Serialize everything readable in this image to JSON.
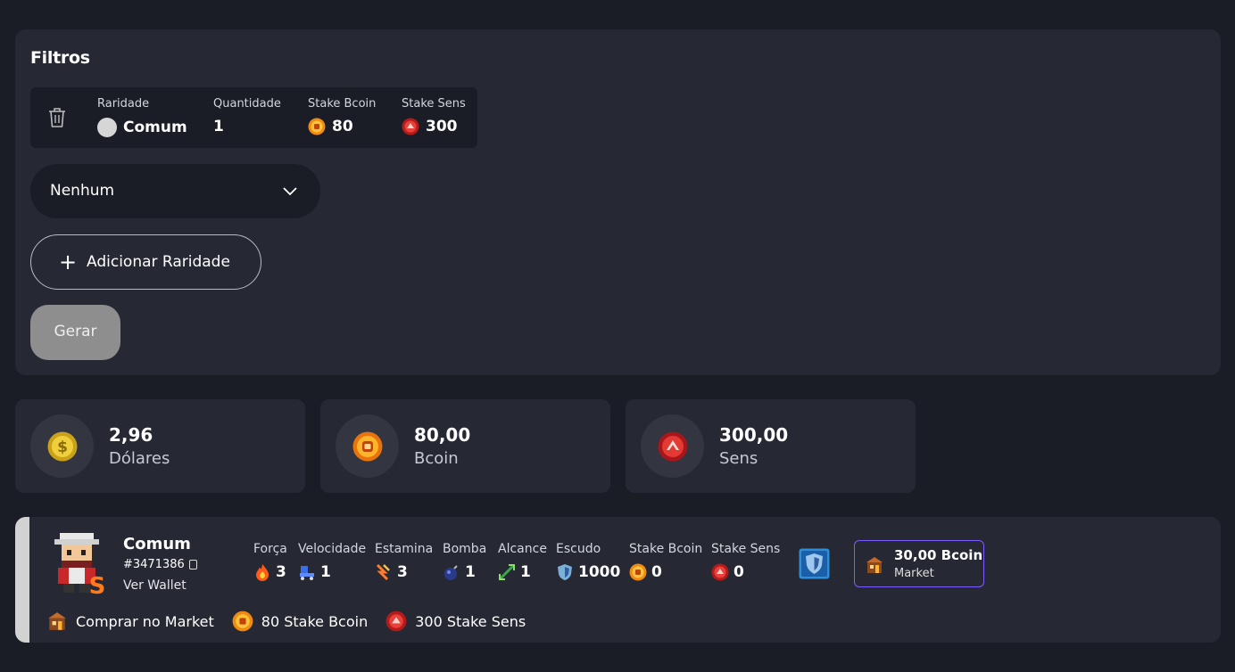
{
  "filters": {
    "title": "Filtros",
    "row": {
      "rarity_label": "Raridade",
      "rarity_value": "Comum",
      "quantity_label": "Quantidade",
      "quantity_value": "1",
      "stake_bcoin_label": "Stake Bcoin",
      "stake_bcoin_value": "80",
      "stake_sens_label": "Stake Sens",
      "stake_sens_value": "300"
    },
    "select_value": "Nenhum",
    "add_button": "Adicionar Raridade",
    "generate_button": "Gerar"
  },
  "stats": [
    {
      "value": "2,96",
      "unit": "Dólares"
    },
    {
      "value": "80,00",
      "unit": "Bcoin"
    },
    {
      "value": "300,00",
      "unit": "Sens"
    }
  ],
  "hero": {
    "name": "Comum",
    "id": "#3471386",
    "wallet_link": "Ver Wallet",
    "attributes": [
      {
        "label": "Força",
        "value": "3",
        "icon": "fire-icon"
      },
      {
        "label": "Velocidade",
        "value": "1",
        "icon": "skate-icon"
      },
      {
        "label": "Estamina",
        "value": "3",
        "icon": "stamina-icon"
      },
      {
        "label": "Bomba",
        "value": "1",
        "icon": "bomb-icon"
      },
      {
        "label": "Alcance",
        "value": "1",
        "icon": "range-icon"
      },
      {
        "label": "Escudo",
        "value": "1000",
        "icon": "shield-icon"
      },
      {
        "label": "Stake Bcoin",
        "value": "0",
        "icon": "bcoin-icon"
      },
      {
        "label": "Stake Sens",
        "value": "0",
        "icon": "sens-icon"
      }
    ],
    "market_price": "30,00 Bcoin",
    "market_label": "Market",
    "actions": {
      "buy": "Comprar no Market",
      "stake_bcoin": "80 Stake Bcoin",
      "stake_sens": "300 Stake Sens"
    }
  },
  "colors": {
    "background": "#1b1d26",
    "panel": "#262834",
    "accent": "#7c5cff",
    "rarity_common": "#d6d6d6",
    "bcoin": "#f5a623",
    "sens": "#e0312f"
  }
}
